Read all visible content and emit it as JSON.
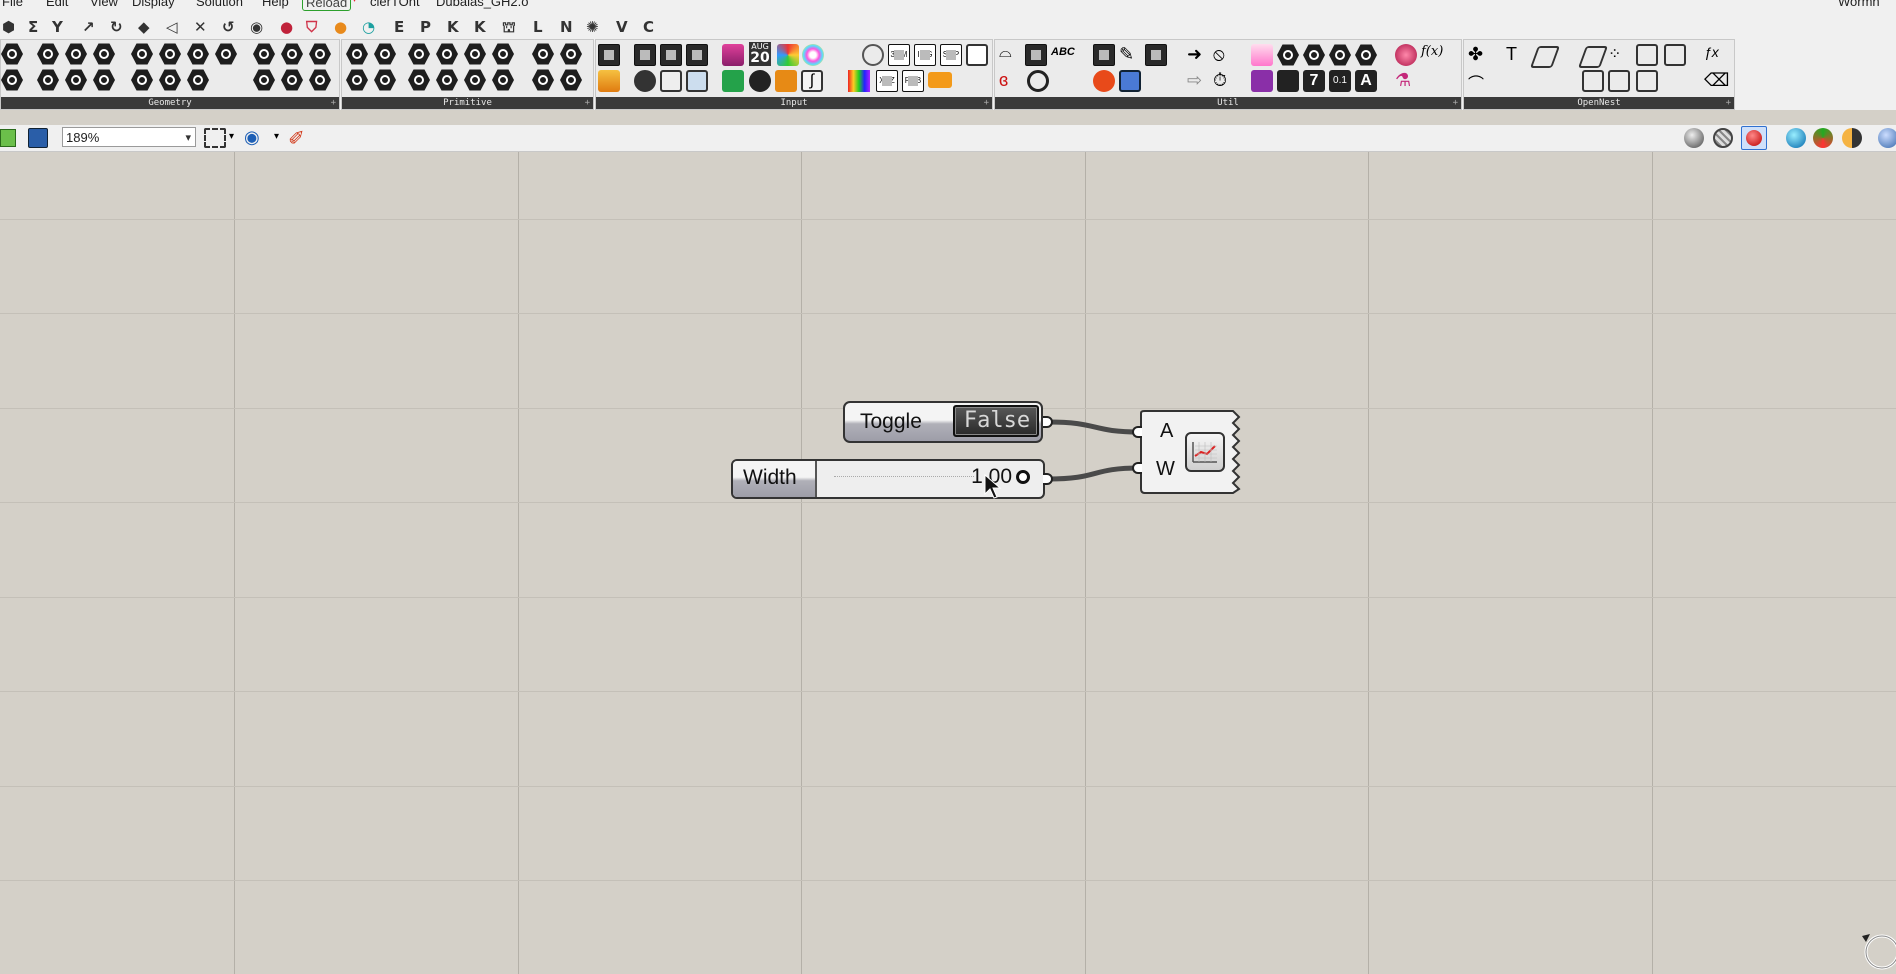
{
  "menu": {
    "items": [
      "File",
      "Edit",
      "View",
      "Display",
      "Solution",
      "Help",
      "Reload",
      "clerTOnt",
      "Dubaias_GH2.o"
    ],
    "right": "Wormh"
  },
  "tabs": [
    "E",
    "P",
    "K",
    "K",
    "L",
    "N",
    "V",
    "C"
  ],
  "ribbon": {
    "panels": [
      "Geometry",
      "Primitive",
      "Input",
      "Util",
      "OpenNest"
    ],
    "input_icon_text": {
      "calendar_month": "AUG",
      "calendar_day": "20",
      "d3m": "3DM",
      "img": "IMG",
      "shp": "SHP",
      "xyz": "XYZ",
      "pdb": "PDB",
      "num": "0.1",
      "seven": "7",
      "a": "A",
      "d": "D",
      "abc": "ABC",
      "fx": "f(x)"
    }
  },
  "toolbar": {
    "zoom": "189%"
  },
  "canvas": {
    "toggle": {
      "name": "Toggle",
      "value": "False"
    },
    "slider": {
      "name": "Width",
      "value": "1.00"
    },
    "component": {
      "inputs": [
        "A",
        "W"
      ]
    }
  },
  "colors": {
    "canvas": "#d4d0c8",
    "wire": "#4a4a4a",
    "panel_label_bg": "#3a3a3a"
  }
}
